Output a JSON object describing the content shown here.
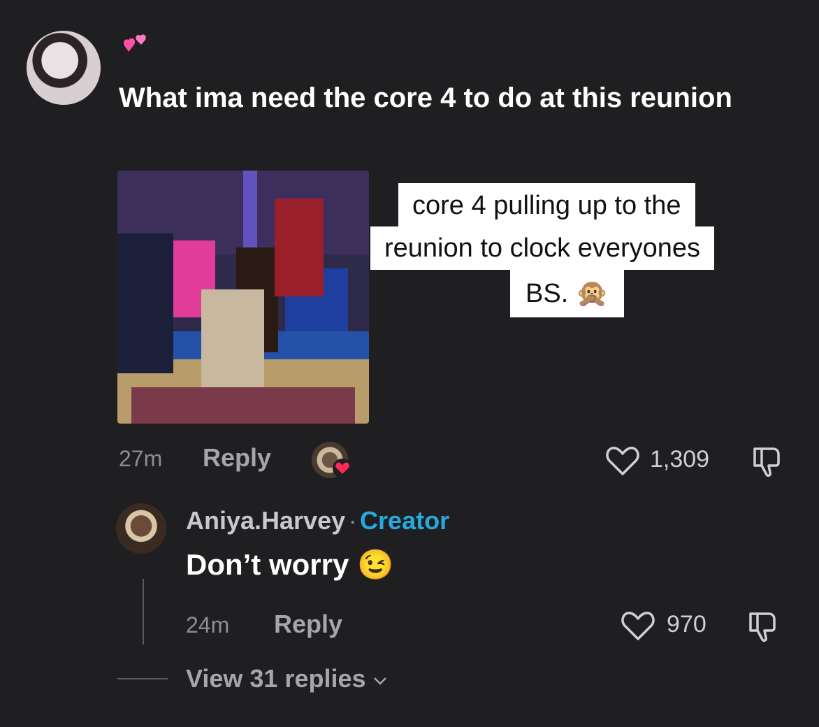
{
  "comment": {
    "emoji": "💕",
    "text": "What ima need the core 4 to do at this reunion",
    "time": "27m",
    "reply_label": "Reply",
    "likes": "1,309",
    "image_caption": {
      "line1": "core 4 pulling up to the",
      "line2": "reunion to clock everyones",
      "line3": "BS. 🙊"
    }
  },
  "reply": {
    "username": "Aniya.Harvey",
    "separator": "·",
    "badge": "Creator",
    "text": "Don’t worry 😉",
    "time": "24m",
    "reply_label": "Reply",
    "likes": "970"
  },
  "view_replies": "View 31 replies",
  "colors": {
    "background": "#1f1f21",
    "creator_badge": "#27a9e0",
    "like_heart": "#ff2a55"
  },
  "icons": [
    "hearts-emoji",
    "heart-outline-icon",
    "dislike-icon",
    "chevron-down-icon",
    "heart-badge-icon"
  ]
}
